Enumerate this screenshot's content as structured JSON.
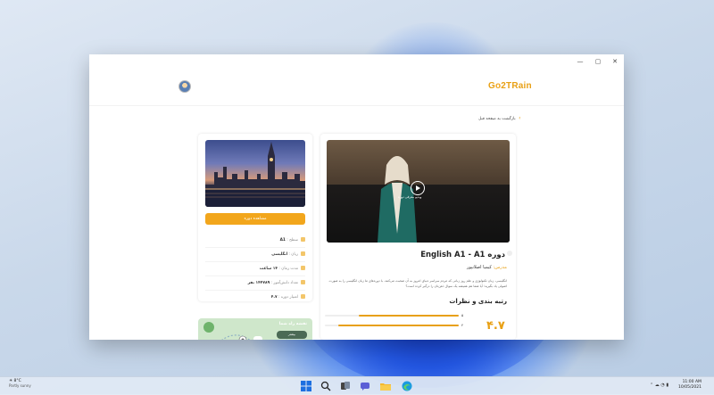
{
  "window": {
    "minimize": "—",
    "maximize": "▢",
    "close": "✕"
  },
  "header": {
    "logo_left": "G",
    "logo_o": "o",
    "logo_right": "2TRain"
  },
  "nav": {
    "back_label": "بازگشت به صفحه قبل",
    "back_icon": "chevron-left-icon"
  },
  "course": {
    "video_caption": "ویدیو معرفی دوره",
    "title": "دوره English A1 - A1",
    "teacher_label": "مدرس:",
    "teacher_name": "کیمیا اصلانپور",
    "description": "انگلیسی، زبان تکنولوژی و علم روز زبانی که مردم سراسر دنیای امروز به آن صحبت می‌کنند. با دوره‌های ما زبان انگلیسی را به صورت اصولی یاد بگیرید؛ آیا شما هم همیشه یک سوال ذهن‌تان را درگیر کرده است؟",
    "rating_title": "رتبه بندی و نظرات",
    "rating_score": "۴.۷",
    "rating_bars": [
      {
        "label": "۵",
        "fill": 0.75
      },
      {
        "label": "۴",
        "fill": 0.9
      }
    ]
  },
  "sidebar": {
    "start_button": "مشاهده دوره",
    "info": [
      {
        "key": "سطح :",
        "value": "A1"
      },
      {
        "key": "زبان :",
        "value": "انگلیسی"
      },
      {
        "key": "مدت زمان :",
        "value": "۱۴ ساعت"
      },
      {
        "key": "تعداد دانش‌آموز :",
        "value": "۱۴۴۷۸۹ نفر"
      },
      {
        "key": "امتیاز دوره :",
        "value": "۴.۷"
      }
    ],
    "map_title": "نقشه راه شما",
    "map_button": "بیشتر"
  },
  "taskbar": {
    "temp": "8°C",
    "weather": "Partly sunny",
    "time": "11:00 AM",
    "date": "10/05/2021",
    "tray": "⌃ ☁ ◔ ▮"
  },
  "colors": {
    "accent": "#e8a015",
    "button": "#f2a61c"
  }
}
